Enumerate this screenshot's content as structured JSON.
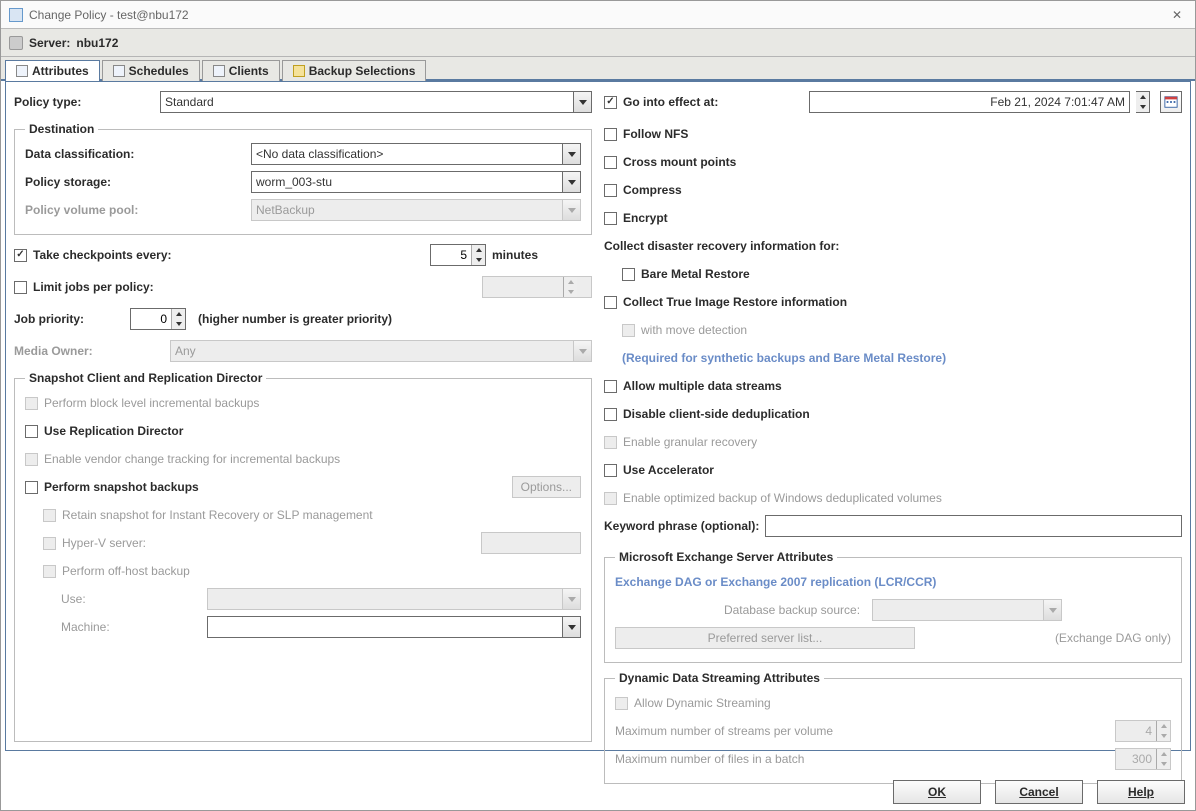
{
  "window": {
    "title": "Change Policy - test@nbu172"
  },
  "server": {
    "label": "Server:",
    "name": "nbu172"
  },
  "tabs": {
    "attributes": "Attributes",
    "schedules": "Schedules",
    "clients": "Clients",
    "backup_selections": "Backup Selections"
  },
  "left": {
    "policy_type": {
      "label": "Policy type:",
      "value": "Standard"
    },
    "destination": {
      "legend": "Destination",
      "data_classification": {
        "label": "Data classification:",
        "value": "<No data classification>"
      },
      "policy_storage": {
        "label": "Policy storage:",
        "value": "worm_003-stu"
      },
      "policy_volume_pool": {
        "label": "Policy volume pool:",
        "value": "NetBackup"
      }
    },
    "checkpoints": {
      "label": "Take checkpoints every:",
      "value": "5",
      "unit": "minutes"
    },
    "limit_jobs": {
      "label": "Limit jobs per policy:",
      "value": ""
    },
    "job_priority": {
      "label": "Job priority:",
      "value": "0",
      "hint": "(higher number is greater priority)"
    },
    "media_owner": {
      "label": "Media Owner:",
      "value": "Any"
    },
    "snapshot": {
      "legend": "Snapshot Client and Replication Director",
      "block_level": "Perform block level incremental backups",
      "use_rep_dir": "Use Replication Director",
      "vendor_change": "Enable vendor change tracking for incremental backups",
      "perform_snapshot": "Perform snapshot backups",
      "options": "Options...",
      "retain_snapshot": "Retain snapshot for Instant Recovery or SLP management",
      "hyperv": "Hyper-V server:",
      "offhost": "Perform off-host backup",
      "use": "Use:",
      "machine": "Machine:"
    }
  },
  "right": {
    "go_into_effect": {
      "label": "Go into effect at:",
      "value": "Feb 21, 2024 7:01:47 AM"
    },
    "follow_nfs": "Follow NFS",
    "cross_mount": "Cross mount points",
    "compress": "Compress",
    "encrypt": "Encrypt",
    "collect_dr": "Collect disaster recovery information for:",
    "bare_metal": "Bare Metal Restore",
    "collect_tir": "Collect True Image Restore information",
    "with_move": "with move detection",
    "with_move_hint": "(Required for synthetic backups and Bare Metal Restore)",
    "allow_multiple": "Allow multiple data streams",
    "disable_dedup": "Disable client-side deduplication",
    "enable_granular": "Enable granular recovery",
    "use_accel": "Use Accelerator",
    "enable_opt": "Enable optimized backup of Windows deduplicated volumes",
    "keyword": {
      "label": "Keyword phrase (optional):",
      "value": ""
    },
    "exchange": {
      "legend": "Microsoft Exchange Server Attributes",
      "subtitle": "Exchange DAG or Exchange 2007 replication (LCR/CCR)",
      "db_source": "Database backup source:",
      "pref_list": "Preferred server list...",
      "dag_only": "(Exchange DAG only)"
    },
    "dynamic": {
      "legend": "Dynamic Data Streaming Attributes",
      "allow": "Allow Dynamic Streaming",
      "max_streams": {
        "label": "Maximum number of streams per volume",
        "value": "4"
      },
      "max_files": {
        "label": "Maximum number of files in a batch",
        "value": "300"
      }
    }
  },
  "footer": {
    "ok": "OK",
    "cancel": "Cancel",
    "help": "Help"
  }
}
